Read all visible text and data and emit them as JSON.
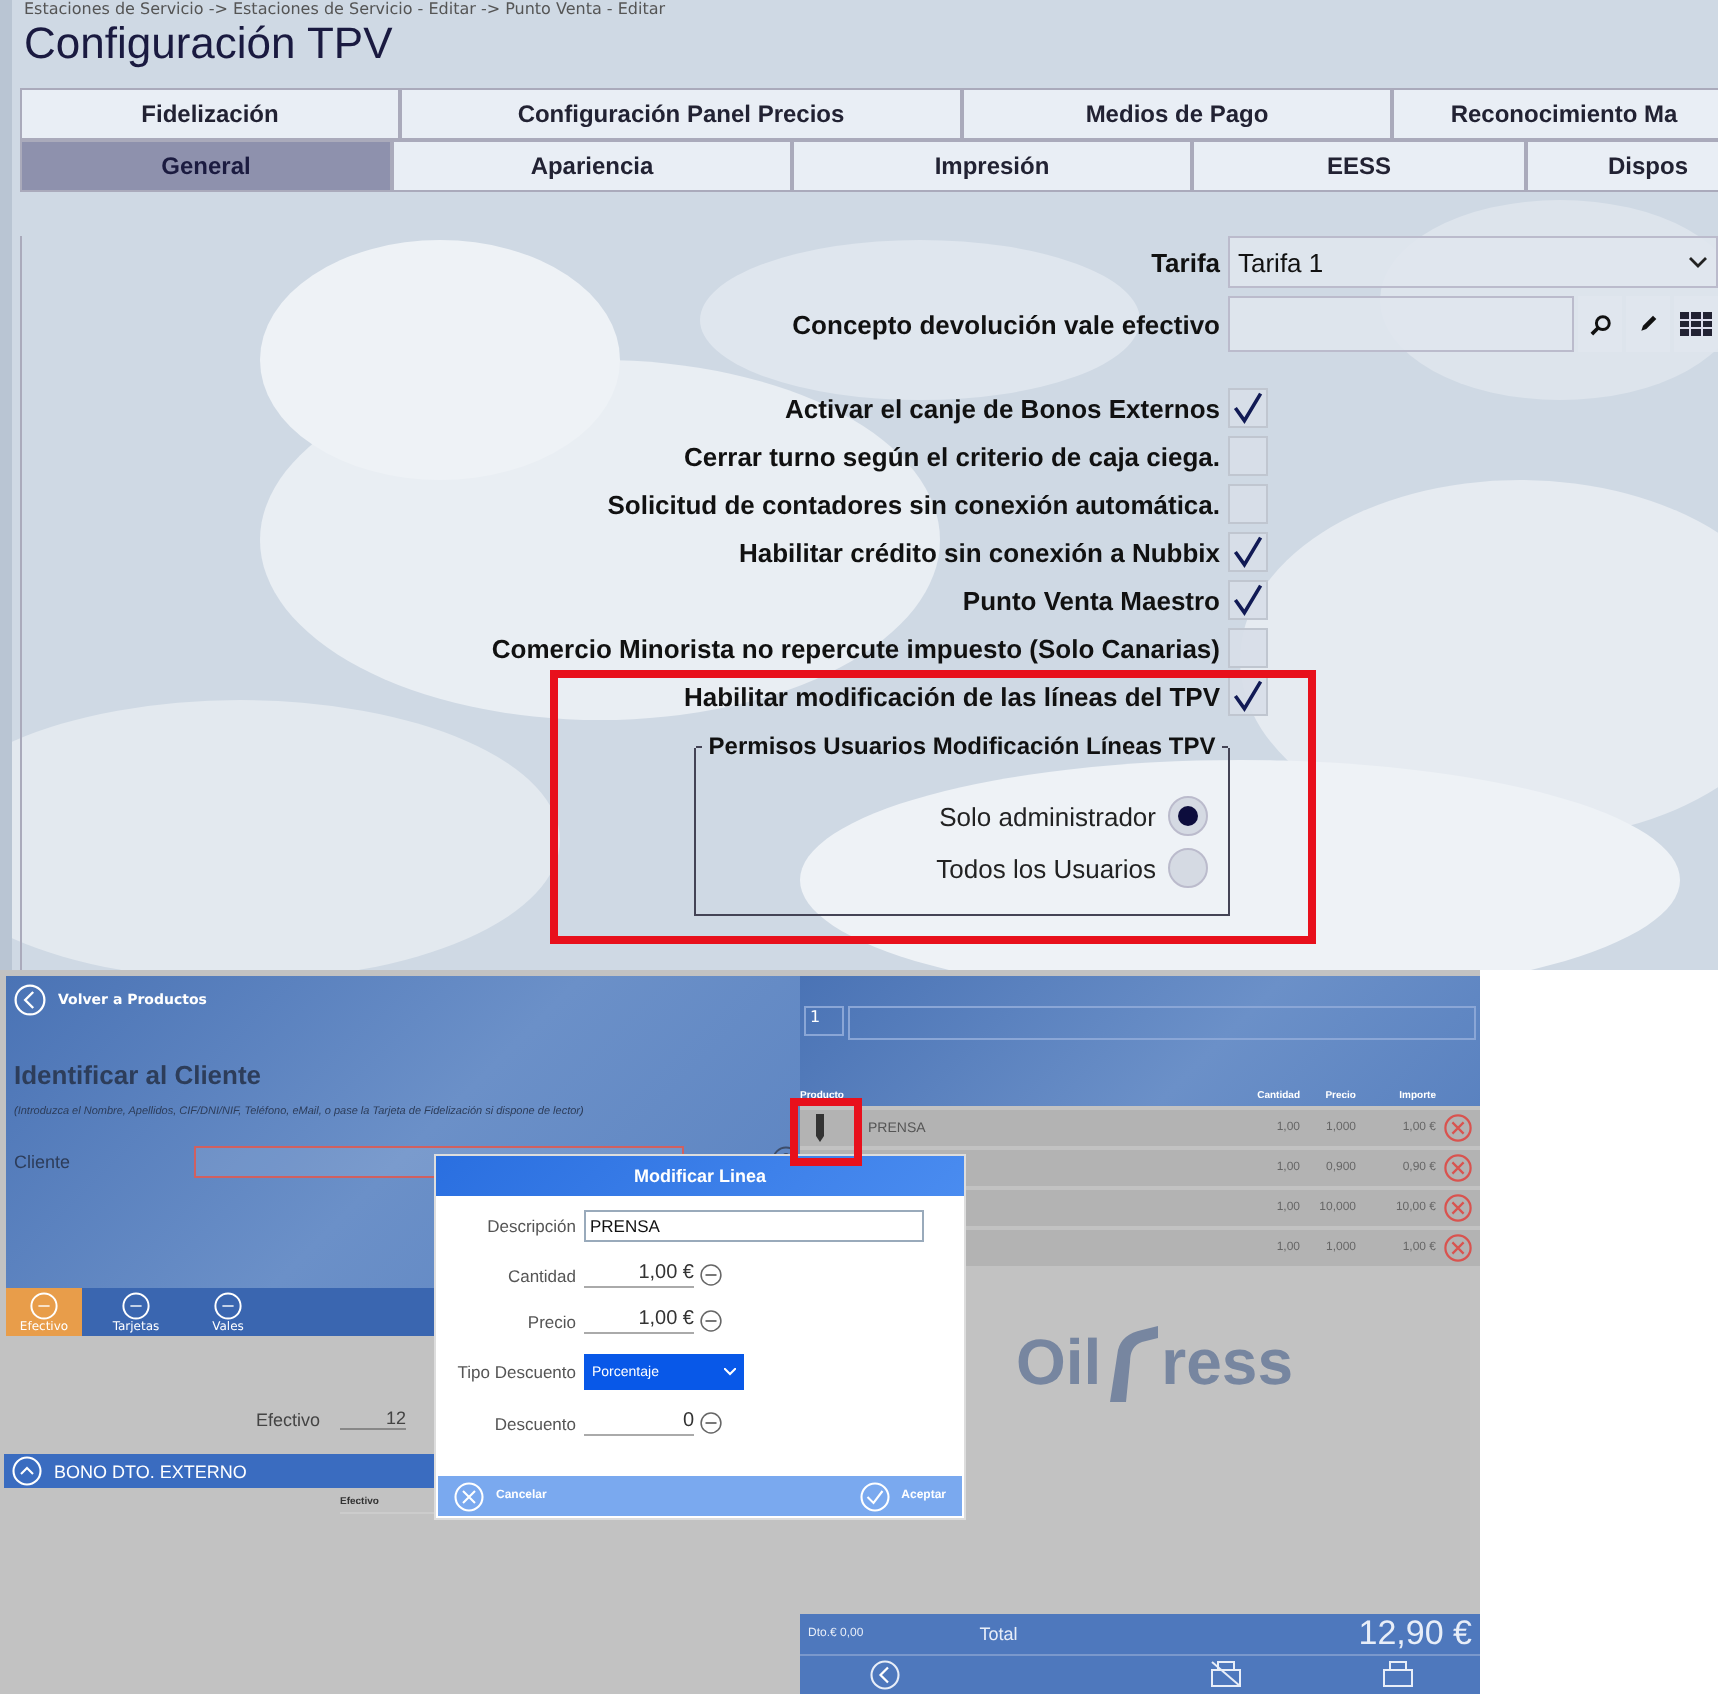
{
  "breadcrumb": "Estaciones de Servicio -> Estaciones de Servicio - Editar -> Punto Venta - Editar",
  "title": "Configuración TPV",
  "tab_rows": [
    [
      {
        "label": "Fidelización",
        "selected": false
      },
      {
        "label": "Configuración Panel Precios",
        "selected": false
      },
      {
        "label": "Medios de Pago",
        "selected": false
      },
      {
        "label": "Reconocimiento Ma",
        "selected": false
      }
    ],
    [
      {
        "label": "General",
        "selected": true
      },
      {
        "label": "Apariencia",
        "selected": false
      },
      {
        "label": "Impresión",
        "selected": false
      },
      {
        "label": "EESS",
        "selected": false
      },
      {
        "label": "Dispos",
        "selected": false
      }
    ]
  ],
  "tarifa": {
    "label": "Tarifa",
    "value": "Tarifa 1"
  },
  "concepto": {
    "label": "Concepto devolución vale efectivo"
  },
  "options": [
    {
      "label": "Activar el canje de Bonos Externos",
      "checked": true
    },
    {
      "label": "Cerrar turno según el criterio de caja ciega.",
      "checked": false
    },
    {
      "label": "Solicitud de contadores sin conexión automática.",
      "checked": false
    },
    {
      "label": "Habilitar crédito sin conexión a Nubbix",
      "checked": true
    },
    {
      "label": "Punto Venta Maestro",
      "checked": true
    },
    {
      "label": "Comercio Minorista no repercute impuesto (Solo Canarias)",
      "checked": false
    },
    {
      "label": "Habilitar modificación de las líneas del TPV",
      "checked": true
    }
  ],
  "permisos": {
    "legend": "Permisos Usuarios Modificación Líneas TPV",
    "options": [
      {
        "label": "Solo administrador",
        "selected": true
      },
      {
        "label": "Todos los Usuarios",
        "selected": false
      }
    ]
  },
  "pos": {
    "back": "Volver a Productos",
    "heading": "Identificar al Cliente",
    "hint": "(Introduzca el Nombre, Apellidos, CIF/DNI/NIF, Teléfono, eMail, o pase la Tarjeta de Fidelización si dispone de lector)",
    "client_label": "Cliente",
    "pay_tabs": [
      {
        "label": "Efectivo",
        "selected": true
      },
      {
        "label": "Tarjetas",
        "selected": false
      },
      {
        "label": "Vales",
        "selected": false
      }
    ],
    "cash_label": "Efectivo",
    "cash_value": "12",
    "voucher_title": "BONO DTO. EXTERNO",
    "voucher_column": "Efectivo",
    "quantity_input": "1",
    "columns": [
      "Producto",
      "Cantidad",
      "Precio",
      "Importe"
    ],
    "lines": [
      {
        "product": "PRENSA",
        "cantidad": "1,00",
        "precio": "1,000",
        "importe": "1,00 €"
      },
      {
        "cantidad": "1,00",
        "precio": "0,900",
        "importe": "0,90 €"
      },
      {
        "cantidad": "1,00",
        "precio": "10,000",
        "importe": "10,00 €"
      },
      {
        "cantidad": "1,00",
        "precio": "1,000",
        "importe": "1,00 €"
      }
    ],
    "logo": [
      "Oil",
      "ress"
    ],
    "discount": "Dto.€ 0,00",
    "total_label": "Total",
    "total": "12,90 €"
  },
  "dialog": {
    "title": "Modificar Linea",
    "fields": [
      {
        "kind": "text",
        "label": "Descripción",
        "value": "PRENSA"
      },
      {
        "kind": "number",
        "label": "Cantidad",
        "value": "1,00 €"
      },
      {
        "kind": "number",
        "label": "Precio",
        "value": "1,00 €"
      },
      {
        "kind": "select",
        "label": "Tipo Descuento",
        "value": "Porcentaje"
      },
      {
        "kind": "number",
        "label": "Descuento",
        "value": "0"
      }
    ],
    "cancel": "Cancelar",
    "accept": "Aceptar"
  }
}
